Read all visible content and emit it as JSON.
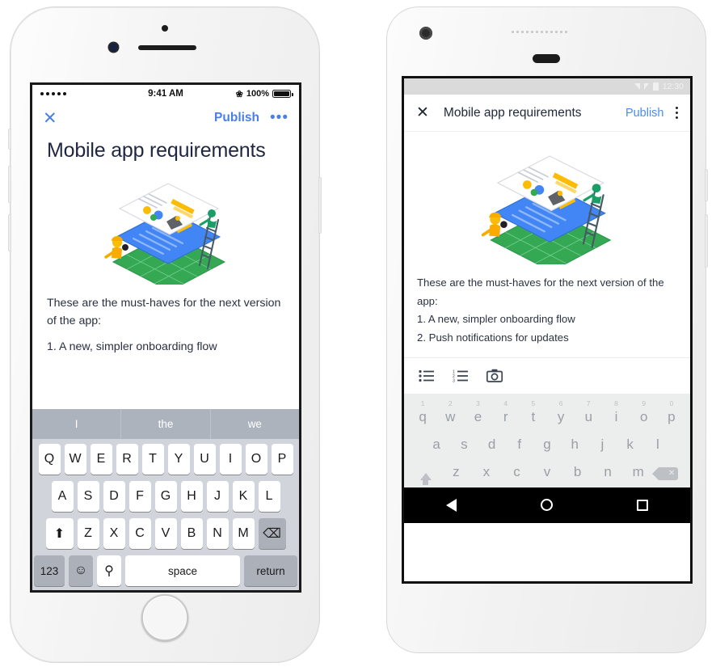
{
  "meta": {
    "accent_blue": "#4a7fe8",
    "android_blue": "#4a8bf5",
    "text_dark": "#222b3a"
  },
  "ios": {
    "status": {
      "time": "9:41 AM",
      "battery_percent": "100%",
      "bluetooth_icon": "bluetooth-icon",
      "signal_dots": 5
    },
    "appbar": {
      "close_label": "✕",
      "publish_label": "Publish",
      "more_label": "•••"
    },
    "document": {
      "title": "Mobile app requirements",
      "illustration_name": "isometric-layered-document-illustration",
      "paragraph": "These are the must-haves for the next version of the app:",
      "list_item_1": "1. A new, simpler onboarding flow"
    },
    "keyboard": {
      "predictions": [
        "I",
        "the",
        "we"
      ],
      "row1": [
        "Q",
        "W",
        "E",
        "R",
        "T",
        "Y",
        "U",
        "I",
        "O",
        "P"
      ],
      "row2": [
        "A",
        "S",
        "D",
        "F",
        "G",
        "H",
        "J",
        "K",
        "L"
      ],
      "row3": [
        "Z",
        "X",
        "C",
        "V",
        "B",
        "N",
        "M"
      ],
      "shift_label": "⬆",
      "delete_label": "⌫",
      "numbers_label": "123",
      "emoji_label": "☺",
      "mic_label": "⚲",
      "space_label": "space",
      "return_label": "return"
    }
  },
  "android": {
    "status": {
      "time": "12:30"
    },
    "appbar": {
      "close_label": "✕",
      "title": "Mobile app requirements",
      "publish_label": "Publish",
      "overflow_name": "overflow-menu-icon"
    },
    "document": {
      "illustration_name": "isometric-layered-document-illustration",
      "paragraph": "These are the must-haves for the next version of the app:",
      "list_item_1": "1. A new, simpler onboarding flow",
      "list_item_2": "2. Push notifications for updates"
    },
    "format_toolbar": {
      "bulleted_list": "bulleted-list-icon",
      "numbered_list": "numbered-list-icon",
      "camera": "camera-icon"
    },
    "keyboard": {
      "row1": [
        "q",
        "w",
        "e",
        "r",
        "t",
        "y",
        "u",
        "i",
        "o",
        "p"
      ],
      "row1_numbers": [
        "1",
        "2",
        "3",
        "4",
        "5",
        "6",
        "7",
        "8",
        "9",
        "0"
      ],
      "row2": [
        "a",
        "s",
        "d",
        "f",
        "g",
        "h",
        "j",
        "k",
        "l"
      ],
      "row3": [
        "z",
        "x",
        "c",
        "v",
        "b",
        "n",
        "m"
      ],
      "shift_name": "shift-key",
      "delete_name": "backspace-key"
    },
    "navbar": {
      "back": "back-button",
      "home": "home-button",
      "recents": "recents-button"
    }
  }
}
